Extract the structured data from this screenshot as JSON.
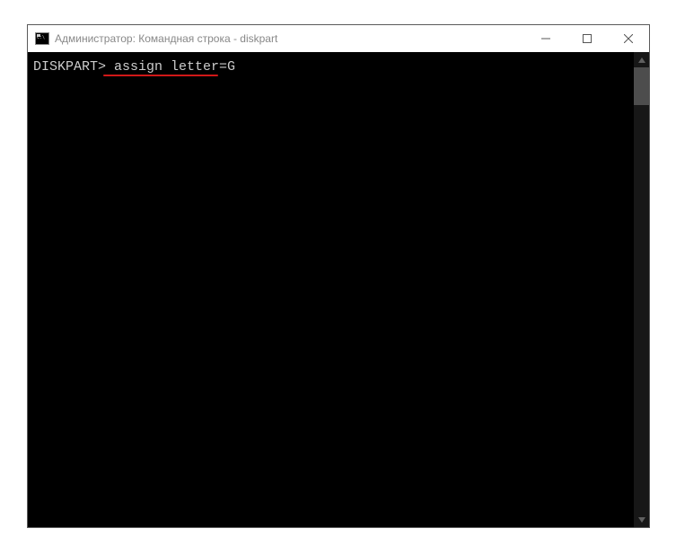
{
  "window": {
    "title": "Администратор: Командная строка - diskpart"
  },
  "terminal": {
    "prompt": "DISKPART>",
    "command": "assign letter=G"
  }
}
